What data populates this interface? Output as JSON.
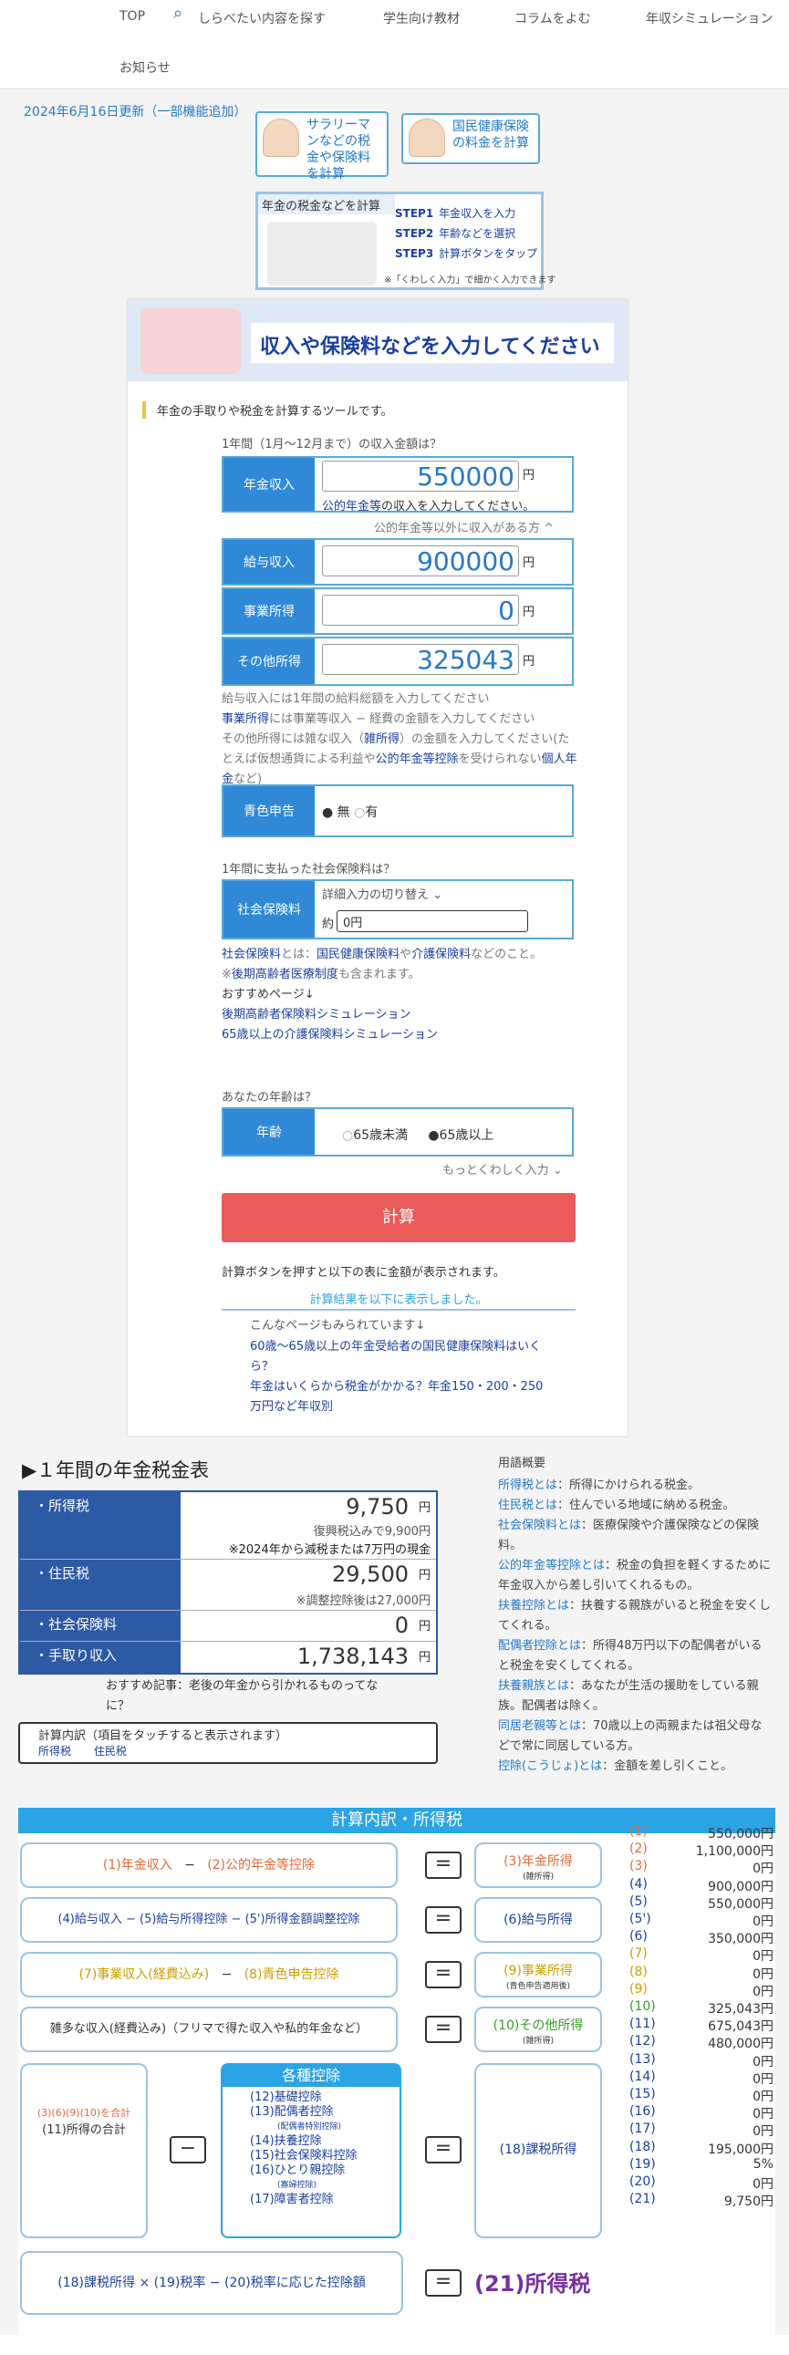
{
  "nav": {
    "items": [
      "TOP",
      "しらべたい内容を探す",
      "学生向け教材",
      "コラムをよむ",
      "年収シミュレーション",
      "お知らせ"
    ]
  },
  "update": "2024年6月16日更新（一部機能追加）",
  "top_buttons": [
    "サラリーマンなどの税金や保険料を計算",
    "国民健康保険の料金を計算"
  ],
  "banner": {
    "head": "年金の税金などを計算",
    "steps": [
      {
        "k": "STEP1",
        "t": "年金収入を入力"
      },
      {
        "k": "STEP2",
        "t": "年齢などを選択"
      },
      {
        "k": "STEP3",
        "t": "計算ボタンをタップ"
      }
    ],
    "note": "※「くわしく入力」で細かく入力できます"
  },
  "form": {
    "title": "収入や保険料などを入力してください",
    "intro": "年金の手取りや税金を計算するツールです。",
    "q1": "1年間（1月〜12月まで）の収入金額は？",
    "pension": {
      "label": "年金収入",
      "value": "550000",
      "unit": "円",
      "note_link": "公的年金等",
      "note": "の収入を入力してください。"
    },
    "other_toggle": "公的年金等以外に収入がある方 ^",
    "salary": {
      "label": "給与収入",
      "value": "900000",
      "unit": "円"
    },
    "business": {
      "label": "事業所得",
      "value": "0",
      "unit": "円"
    },
    "misc": {
      "label": "その他所得",
      "value": "325043",
      "unit": "円"
    },
    "notes1": [
      "給与収入には1年間の給料総額を入力してください",
      "には事業等収入 − 経費の金額を入力してください",
      "その他所得には雑な収入（",
      "）の金額を入力してください(たとえば仮想通貨による利益や",
      "を受けられない",
      "など)"
    ],
    "links1": [
      "事業所得",
      "雑所得",
      "公的年金等控除",
      "個人年金"
    ],
    "blue": {
      "label": "青色申告",
      "opt1": "無",
      "opt2": "有"
    },
    "q2": "1年間に支払った社会保険料は？",
    "social": {
      "label": "社会保険料",
      "toggle": "詳細入力の切り替え ⌄",
      "prefix": "約",
      "value": "0円"
    },
    "notes2": [
      "とは：",
      "や",
      "などのこと。",
      "※",
      "も含まれます。",
      "おすすめページ↓"
    ],
    "links2": [
      "社会保険料",
      "国民健康保険料",
      "介護保険料",
      "後期高齢者医療制度",
      "後期高齢者保険料シミュレーション",
      "65歳以上の介護保険料シミュレーション"
    ],
    "q3": "あなたの年齢は？",
    "age": {
      "label": "年齢",
      "opt1": "65歳未満",
      "opt2": "65歳以上"
    },
    "more": "もっとくわしく入力 ⌄",
    "calc": "計算",
    "after1": "計算ボタンを押すと以下の表に金額が表示されます。",
    "after2": "計算結果を以下に表示しました。",
    "also": "こんなページもみられています↓",
    "also_links": [
      "60歳〜65歳以上の年金受給者の国民健康保険料はいくら？",
      "年金はいくらから税金がかかる？年金150・200・250万円など年収別"
    ]
  },
  "summary": {
    "title": "▶１年間の年金税金表",
    "rows": [
      {
        "k": "・所得税",
        "v": "9,750",
        "y": "円",
        "s1": "復興税込みで9,900円",
        "s2": "※2024年から減税または7万円の現金"
      },
      {
        "k": "・住民税",
        "v": "29,500",
        "y": "円",
        "s1": "※調整控除後は27,000円"
      },
      {
        "k": "・社会保険料",
        "v": "0",
        "y": "円"
      },
      {
        "k": "・手取り収入",
        "v": "1,738,143",
        "y": "円"
      }
    ],
    "rec": "おすすめ記事：老後の年金から引かれるものってなに？",
    "detail_title": "計算内訳（項目をタッチすると表示されます）",
    "detail_links": [
      "所得税",
      "住民税"
    ]
  },
  "glossary": {
    "title": "用語概要",
    "items": [
      {
        "t": "所得税とは",
        "d": "：所得にかけられる税金。"
      },
      {
        "t": "住民税とは",
        "d": "：住んでいる地域に納める税金。"
      },
      {
        "t": "社会保険料とは",
        "d": "：医療保険や介護保険などの保険料。"
      },
      {
        "t": "公的年金等控除とは",
        "d": "：税金の負担を軽くするために年金収入から差し引いてくれるもの。"
      },
      {
        "t": "扶養控除とは",
        "d": "：扶養する親族がいると税金を安くしてくれる。"
      },
      {
        "t": "配偶者控除とは",
        "d": "：所得48万円以下の配偶者がいると税金を安くしてくれる。"
      },
      {
        "t": "扶養親族とは",
        "d": "：あなたが生活の援助をしている親族。配偶者は除く。"
      },
      {
        "t": "同居老親等とは",
        "d": "：70歳以上の両親または祖父母などで常に同居している方。"
      },
      {
        "t": "控除(こうじょ)とは",
        "d": "：金額を差し引くこと。"
      }
    ]
  },
  "breakdown": {
    "title": "計算内訳・所得税",
    "r1": [
      "(1)年金収入",
      "−",
      "(2)公的年金等控除",
      "(3)年金所得",
      "(雑所得)"
    ],
    "r2": [
      "(4)給与収入 − (5)給与所得控除 − (5')所得金額調整控除",
      "(6)給与所得"
    ],
    "r3": [
      "(7)事業収入(経費込み)",
      "−",
      "(8)青色申告控除",
      "(9)事業所得",
      "(青色申告適用後)"
    ],
    "r4": [
      "雑多な収入(経費込み)（フリマで得た収入や私的年金など）",
      "(10)その他所得",
      "(雑所得)"
    ],
    "r5left": [
      "(3)(6)(9)(10)を合計",
      "(11)所得の合計"
    ],
    "deductions": {
      "title": "各種控除",
      "items": [
        "(12)基礎控除",
        "(13)配偶者控除",
        "(配偶者特別控除)",
        "(14)扶養控除",
        "(15)社会保険料控除",
        "(16)ひとり親控除",
        "(寡婦控除)",
        "(17)障害者控除"
      ]
    },
    "r5right": "(18)課税所得",
    "r6": "(18)課税所得 × (19)税率 − (20)税率に応じた控除額",
    "r6res": "(21)所得税",
    "eq": "=",
    "minus": "−",
    "values": [
      [
        "(1)",
        "550,000円"
      ],
      [
        "(2)",
        "1,100,000円"
      ],
      [
        "(3)",
        "0円"
      ],
      [
        "(4)",
        "900,000円"
      ],
      [
        "(5)",
        "550,000円"
      ],
      [
        "(5')",
        "0円"
      ],
      [
        "(6)",
        "350,000円"
      ],
      [
        "(7)",
        "0円"
      ],
      [
        "(8)",
        "0円"
      ],
      [
        "(9)",
        "0円"
      ],
      [
        "(10)",
        "325,043円"
      ],
      [
        "(11)",
        "675,043円"
      ],
      [
        "(12)",
        "480,000円"
      ],
      [
        "(13)",
        "0円"
      ],
      [
        "(14)",
        "0円"
      ],
      [
        "(15)",
        "0円"
      ],
      [
        "(16)",
        "0円"
      ],
      [
        "(17)",
        "0円"
      ],
      [
        "(18)",
        "195,000円"
      ],
      [
        "(19)",
        "5%"
      ],
      [
        "(20)",
        "0円"
      ],
      [
        "(21)",
        "9,750円"
      ]
    ]
  }
}
